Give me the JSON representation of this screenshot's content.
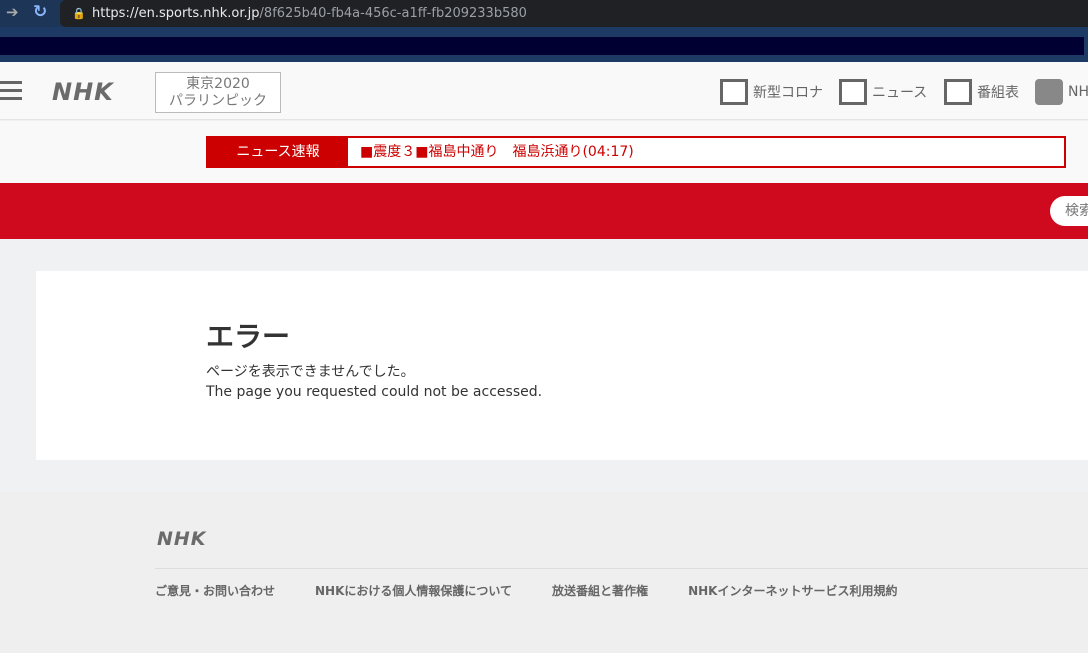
{
  "browser": {
    "url_host": "https://en.sports.nhk.or.jp",
    "url_path": "/8f625b40-fb4a-456c-a1ff-fb209233b580"
  },
  "header": {
    "logo": "NHK",
    "paralympic_line1": "東京2020",
    "paralympic_line2": "パラリンピック",
    "nav": [
      {
        "label": "新型コロナ",
        "icon": "corona-icon"
      },
      {
        "label": "ニュース",
        "icon": "news-icon"
      },
      {
        "label": "番組表",
        "icon": "program-guide-icon"
      },
      {
        "label": "NH",
        "icon": "nhk-app-icon"
      }
    ]
  },
  "ticker": {
    "label": "ニュース速報",
    "text": "■震度３■福島中通り　福島浜通り(04:17)"
  },
  "search": {
    "label": "検索"
  },
  "main": {
    "title": "エラー",
    "message_ja": "ページを表示できませんでした。",
    "message_en": "The page you requested could not be accessed."
  },
  "footer": {
    "logo": "NHK",
    "links": [
      "ご意見・お問い合わせ",
      "NHKにおける個人情報保護について",
      "放送番組と著作権",
      "NHKインターネットサービス利用規約"
    ]
  }
}
